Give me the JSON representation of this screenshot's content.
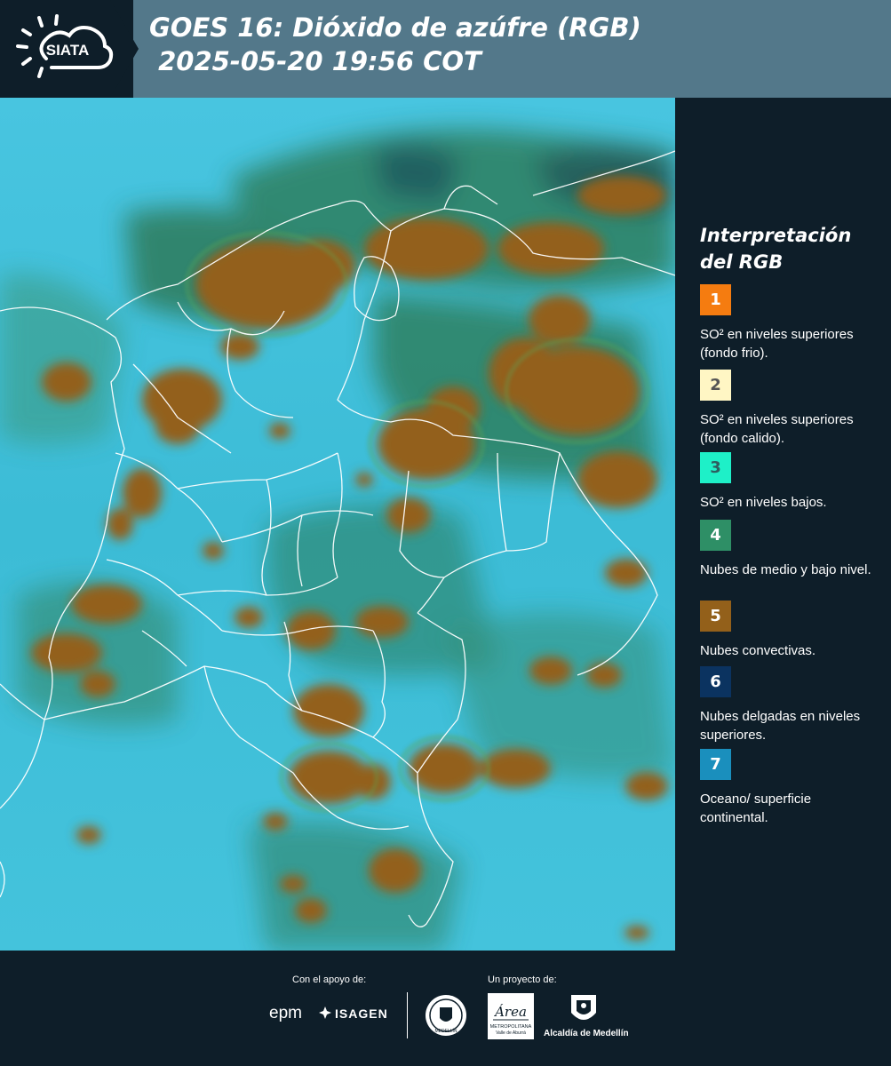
{
  "header": {
    "logo_text": "SIATA",
    "title_line1": "GOES 16: Dióxido de azúfre (RGB)",
    "title_line2": " 2025-05-20 19:56 COT"
  },
  "legend": {
    "title": "Interpretación del RGB",
    "items": [
      {
        "number": "1",
        "color": "#f57c10",
        "number_color": "#ffffff",
        "text": "SO² en niveles superiores (fondo frio)."
      },
      {
        "number": "2",
        "color": "#fff6c4",
        "number_color": "#555555",
        "text": "SO² en niveles superiores (fondo calido)."
      },
      {
        "number": "3",
        "color": "#1ef0c8",
        "number_color": "#2e5d60",
        "text": "SO² en niveles bajos."
      },
      {
        "number": "4",
        "color": "#2e8f66",
        "number_color": "#ffffff",
        "text": "Nubes de medio y bajo nivel."
      },
      {
        "number": "5",
        "color": "#93601a",
        "number_color": "#ffffff",
        "text": "Nubes convectivas."
      },
      {
        "number": "6",
        "color": "#0b3360",
        "number_color": "#ffffff",
        "text": "Nubes delgadas en niveles superiores."
      },
      {
        "number": "7",
        "color": "#1a8fbd",
        "number_color": "#ffffff",
        "text": "Oceano/ superficie continental."
      }
    ]
  },
  "footer": {
    "support_label": "Con el apoyo de:",
    "project_label": "Un proyecto de:",
    "sponsor_epm": "epm",
    "sponsor_isagen": "ISAGEN",
    "sponsor_medellin_seal": "MEDELLÍN",
    "sponsor_area_name": "Área",
    "sponsor_area_sub": "METROPOLITANA",
    "sponsor_area_sub2": "Valle de Aburrá",
    "sponsor_alcaldia": "Alcaldía de Medellín"
  },
  "colors": {
    "background": "#0e1e29",
    "header_band": "#53788a",
    "ocean_surface": "#3dbfd8",
    "convective_cloud": "#93601a",
    "mid_low_cloud": "#2e8f66",
    "border_lines": "#ffffff"
  }
}
